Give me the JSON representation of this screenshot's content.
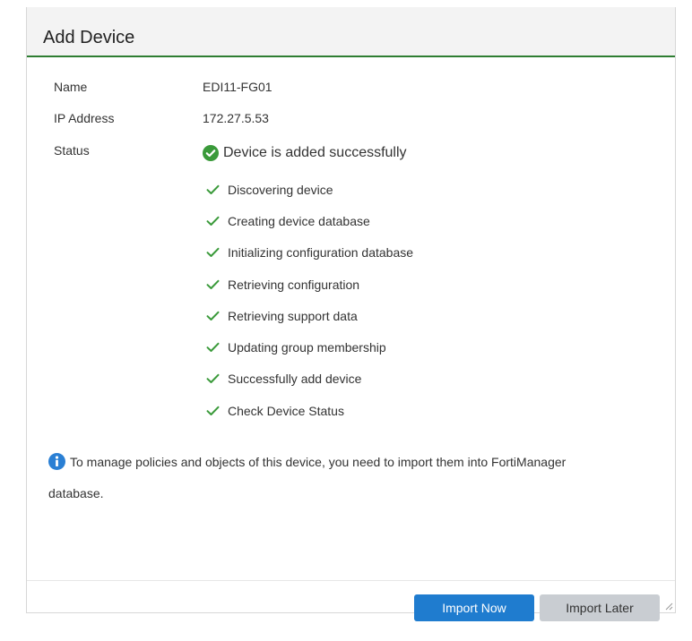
{
  "dialog": {
    "title": "Add Device",
    "fields": {
      "name_label": "Name",
      "name_value": "EDI11-FG01",
      "ip_label": "IP Address",
      "ip_value": "172.27.5.53",
      "status_label": "Status"
    },
    "status_message": "Device is added successfully",
    "steps": [
      "Discovering device",
      "Creating device database",
      "Initializing configuration database",
      "Retrieving configuration",
      "Retrieving support data",
      "Updating group membership",
      "Successfully add device",
      "Check Device Status"
    ],
    "info": {
      "line1": "To manage policies and objects of this device, you need to import them into FortiManager",
      "line2": "database."
    },
    "buttons": {
      "import_now": "Import Now",
      "import_later": "Import Later"
    }
  },
  "colors": {
    "success": "#3a9a3a",
    "accent_green": "#2e7d32",
    "primary_button": "#1f7ccf",
    "info_icon": "#2a7fd4"
  },
  "icons": {
    "status": "check-circle-icon",
    "step": "check-icon",
    "info": "info-icon"
  }
}
